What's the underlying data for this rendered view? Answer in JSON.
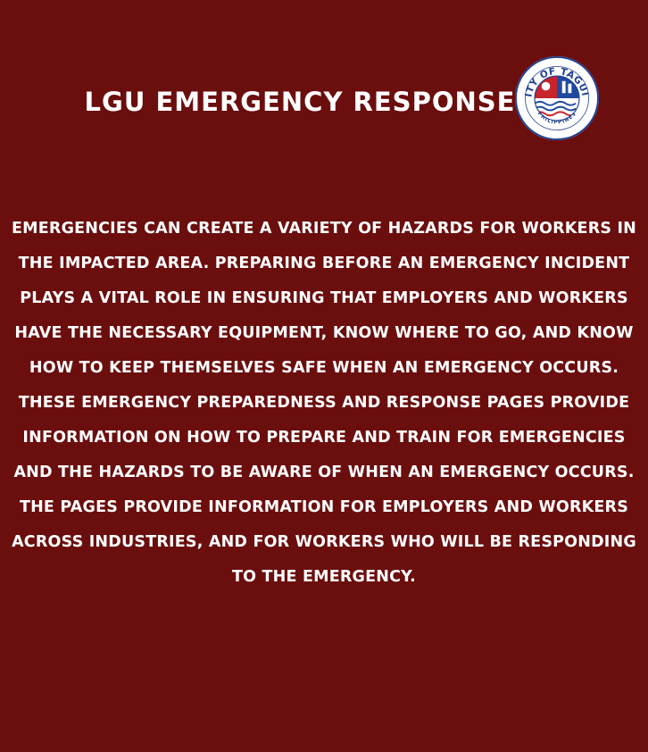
{
  "header": {
    "title": "LGU EMERGENCY RESPONSE",
    "seal": {
      "ring_text_top": "CITY OF TAGUIG",
      "ring_text_bottom": "PHILIPPINES",
      "colors": {
        "ring": "#ffffff",
        "border": "#1f3f8f",
        "text": "#1f3f8f",
        "red": "#c8242b",
        "blue": "#1f4aa0"
      }
    }
  },
  "main": {
    "paragraph": "Emergencies can create a variety of  hazards for workers in the impacted area. Preparing before an emergency incident plays a vital role in ensuring that employers and workers have the necessary equipment, know where to go, and know how to keep themselves safe when an emergency occurs. These Emergency Preparedness and Response Pages provide information on how to prepare and train for emergencies and the hazards to be aware of when an emergency occurs. The pages provide information for employers and workers across industries, and for workers who will be responding to the emergency."
  },
  "theme": {
    "background": "#6b0e0e",
    "text": "#ffffff"
  }
}
